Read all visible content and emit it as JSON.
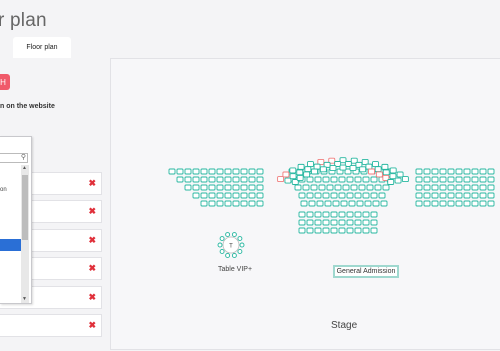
{
  "header": {
    "title": "r plan"
  },
  "tabs": [
    {
      "label": "Floor plan"
    }
  ],
  "left": {
    "add_button_label": "H",
    "website_label": "n on the website",
    "dropdown": {
      "item_partial": "on"
    },
    "row_delete_icon": "close-icon"
  },
  "canvas": {
    "vip_table": {
      "center_label": "T",
      "name": "Table VIP+"
    },
    "general_admission_label": "General Admission",
    "stage_label": "Stage"
  },
  "colors": {
    "seat": "#27b7a0",
    "reserved_seat": "#f07c7c",
    "accent_red": "#f05a6a",
    "selection_blue": "#2a6fd6"
  }
}
